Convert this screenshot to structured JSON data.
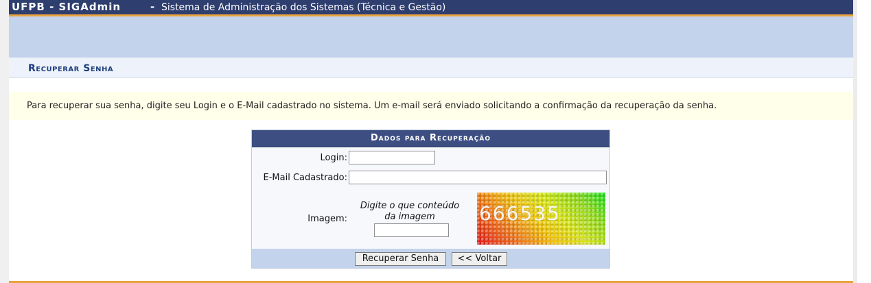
{
  "header": {
    "brand": "UFPB - SIGAdmin",
    "separator": "-",
    "subtitle": "Sistema de Administração dos Sistemas (Técnica e Gestão)"
  },
  "section": {
    "title": "Recuperar Senha"
  },
  "info": {
    "message": "Para recuperar sua senha, digite seu Login e o E-Mail cadastrado no sistema. Um e-mail será enviado solicitando a confirmação da recuperação da senha."
  },
  "form": {
    "caption": "Dados para Recuperação",
    "login_label": "Login:",
    "login_value": "",
    "email_label": "E-Mail Cadastrado:",
    "email_value": "",
    "image_label": "Imagem:",
    "captcha_hint": "Digite o que conteúdo da imagem",
    "captcha_value": "",
    "captcha_text": "666535",
    "submit_label": "Recuperar Senha",
    "back_label": "<< Voltar"
  },
  "colors": {
    "topbar": "#2e3e6f",
    "accent_orange": "#e8a33c",
    "band_blue": "#c4d3ec",
    "section_title": "#1e3f7e",
    "info_bg": "#ffffea"
  }
}
